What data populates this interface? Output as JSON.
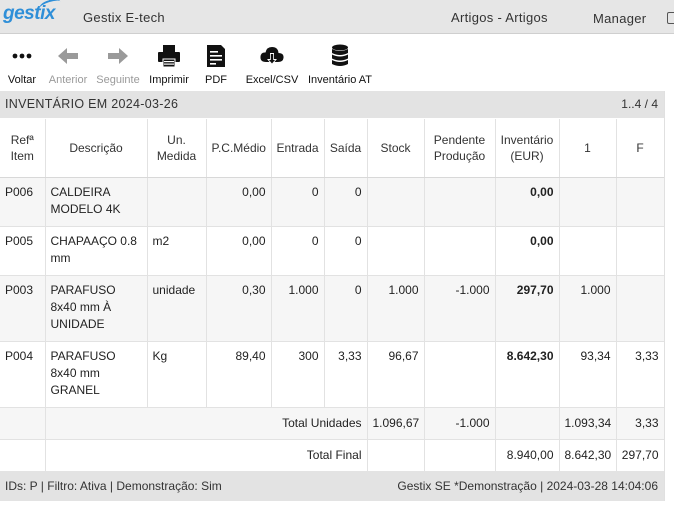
{
  "header": {
    "logo": "gestix",
    "app_title": "Gestix E-tech",
    "module_title": "Artigos - Artigos",
    "user": "Manager",
    "accent": "#2f8fd8"
  },
  "toolbar": {
    "items": [
      {
        "label": "Voltar",
        "icon": "more-dots-icon",
        "disabled": false
      },
      {
        "label": "Anterior",
        "icon": "arrow-left-icon",
        "disabled": true
      },
      {
        "label": "Seguinte",
        "icon": "arrow-right-icon",
        "disabled": true
      },
      {
        "label": "Imprimir",
        "icon": "printer-icon",
        "disabled": false
      },
      {
        "label": "PDF",
        "icon": "pdf-document-icon",
        "disabled": false
      },
      {
        "label": "Excel/CSV",
        "icon": "cloud-download-icon",
        "disabled": false
      },
      {
        "label": "Inventário AT",
        "icon": "database-icon",
        "disabled": false
      }
    ]
  },
  "section": {
    "title": "INVENTÁRIO EM 2024-03-26",
    "pager": "1..4 / 4"
  },
  "table": {
    "columns": [
      "Refª\nItem",
      "Descrição",
      "Un.\nMedida",
      "P.C.Médio",
      "Entrada",
      "Saída",
      "Stock",
      "Pendente\nProdução",
      "Inventário\n(EUR)",
      "1",
      "F"
    ],
    "rows": [
      {
        "ref": "P006",
        "desc": "CALDEIRA MODELO 4K",
        "un": "",
        "pcm": "0,00",
        "entrada": "0",
        "saida": "0",
        "stock": "",
        "pendente": "",
        "inventario": "0,00",
        "c1": "",
        "cf": ""
      },
      {
        "ref": "P005",
        "desc": "CHAPAAÇO 0.8 mm",
        "un": "m2",
        "pcm": "0,00",
        "entrada": "0",
        "saida": "0",
        "stock": "",
        "pendente": "",
        "inventario": "0,00",
        "c1": "",
        "cf": ""
      },
      {
        "ref": "P003",
        "desc": "PARAFUSO 8x40 mm À UNIDADE",
        "un": "unidade",
        "pcm": "0,30",
        "entrada": "1.000",
        "saida": "0",
        "stock": "1.000",
        "pendente": "-1.000",
        "inventario": "297,70",
        "c1": "1.000",
        "cf": ""
      },
      {
        "ref": "P004",
        "desc": "PARAFUSO 8x40 mm GRANEL",
        "un": "Kg",
        "pcm": "89,40",
        "entrada": "300",
        "saida": "3,33",
        "stock": "96,67",
        "pendente": "",
        "inventario": "8.642,30",
        "c1": "93,34",
        "cf": "3,33"
      }
    ],
    "total_unidades": {
      "label": "Total Unidades",
      "stock": "1.096,67",
      "pendente": "-1.000",
      "inventario": "",
      "c1": "1.093,34",
      "cf": "3,33"
    },
    "total_final": {
      "label": "Total Final",
      "inventario": "8.940,00",
      "c1": "8.642,30",
      "cf": "297,70"
    }
  },
  "footer": {
    "left": "IDs: P | Filtro: Ativa | Demonstração: Sim",
    "right": "Gestix SE *Demonstração | 2024-03-28 14:04:06"
  }
}
